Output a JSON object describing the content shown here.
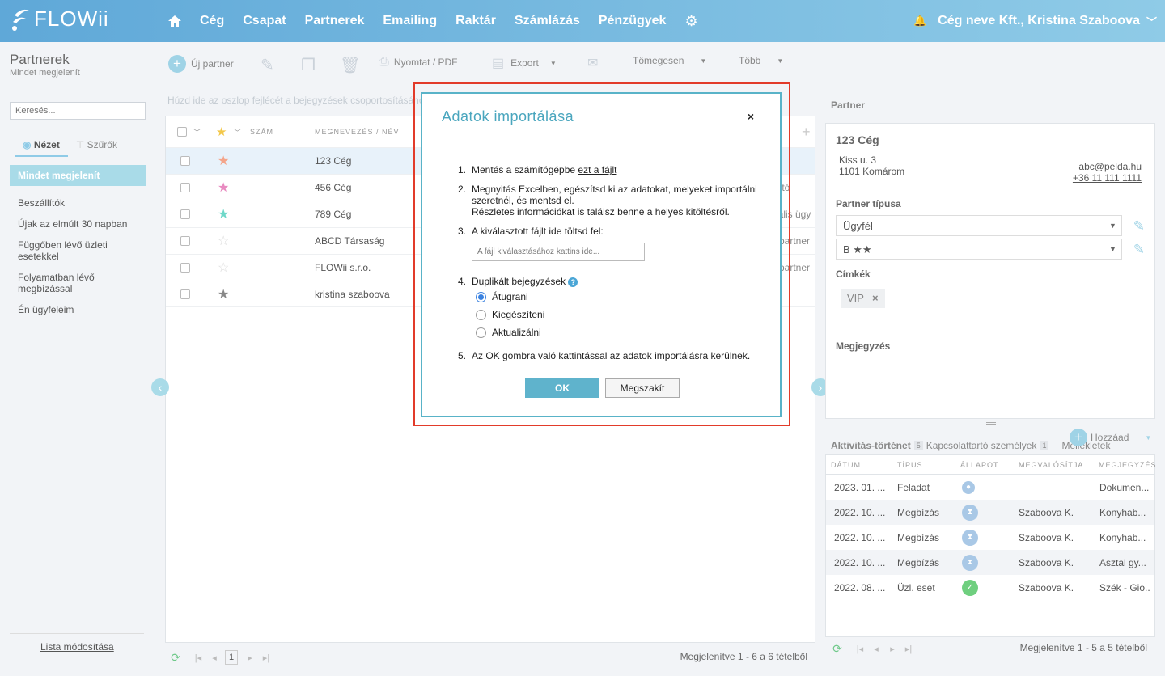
{
  "app": {
    "logo_text": "FLOWii"
  },
  "nav": {
    "items": [
      "Cég",
      "Csapat",
      "Partnerek",
      "Emailing",
      "Raktár",
      "Számlázás",
      "Pénzügyek"
    ]
  },
  "company": {
    "name": "Cég neve Kft., Kristina Szaboova"
  },
  "sidebar": {
    "title": "Partnerek",
    "subtitle": "Mindet megjelenít",
    "search_placeholder": "Keresés...",
    "tab_view": "Nézet",
    "tab_filters": "Szűrők",
    "items": [
      "Mindet megjelenít",
      "Beszállítók",
      "Újak az elmúlt 30 napban",
      "Függőben lévő üzleti esetekkel",
      "Folyamatban lévő megbízással",
      "Én ügyfeleim"
    ],
    "edit_list": "Lista módosítása"
  },
  "toolbar": {
    "new_partner": "Új partner",
    "print": "Nyomtat / PDF",
    "export": "Export",
    "bulk": "Tömegesen",
    "more": "Több"
  },
  "grid": {
    "group_hint": "Húzd ide az oszlop fejlécét a bejegyzések csoportosításához",
    "col_number": "SZÁM",
    "col_name": "MEGNEVEZÉS / NÉV",
    "rows": [
      {
        "name": "123 Cég",
        "star_color": "#f4a58a",
        "right": ""
      },
      {
        "name": "456 Cég",
        "star_color": "#e88ac0",
        "right": "ító"
      },
      {
        "name": "789 Cég",
        "star_color": "#6fd8c9",
        "right": "iális ügy"
      },
      {
        "name": "ABCD Társaság",
        "star_color": "#dcdcdc",
        "right": "partner"
      },
      {
        "name": "FLOWii s.r.o.",
        "star_color": "#dcdcdc",
        "right": "partner"
      },
      {
        "name": "kristina szaboova",
        "star_color": "#888888",
        "right": ""
      }
    ],
    "page": "1",
    "footer": "Megjelenítve 1 - 6 a 6 tételből"
  },
  "partner": {
    "label": "Partner",
    "name": "123 Cég",
    "address_line1": "Kiss u. 3",
    "address_line2": "1101 Komárom",
    "email": "abc@pelda.hu",
    "phone": "+36 11 111 1111",
    "type_label": "Partner típusa",
    "type_value": "Ügyfél",
    "rating_value": "B ★★",
    "tags_label": "Címkék",
    "tag": "VIP",
    "note_label": "Megjegyzés"
  },
  "activity": {
    "tab_history": "Aktivitás-történet",
    "history_count": "5",
    "tab_contacts": "Kapcsolattartó személyek",
    "contacts_count": "1",
    "tab_attachments": "Mellékletek",
    "add": "Hozzáad",
    "cols": [
      "DÁTUM",
      "TÍPUS",
      "ÁLLAPOT",
      "MEGVALÓSÍTJA",
      "MEGJEGYZÉS"
    ],
    "rows": [
      {
        "date": "2023. 01. ...",
        "type": "Feladat",
        "status_icon": "pending-icon",
        "by": "",
        "note": "Dokumen..."
      },
      {
        "date": "2022. 10. ...",
        "type": "Megbízás",
        "status_icon": "hourglass-icon",
        "by": "Szaboova K.",
        "note": "Konyhab..."
      },
      {
        "date": "2022. 10. ...",
        "type": "Megbízás",
        "status_icon": "hourglass-icon",
        "by": "Szaboova K.",
        "note": "Konyhab..."
      },
      {
        "date": "2022. 10. ...",
        "type": "Megbízás",
        "status_icon": "hourglass-icon",
        "by": "Szaboova K.",
        "note": "Asztal gy..."
      },
      {
        "date": "2022. 08. ...",
        "type": "Üzl. eset",
        "status_icon": "check-icon",
        "by": "Szaboova K.",
        "note": "Szék - Gio..."
      }
    ],
    "footer": "Megjelenítve 1 - 5 a 5 tételből"
  },
  "modal": {
    "title": "Adatok importálása",
    "close": "×",
    "step1_text": "Mentés a számítógépbe ",
    "step1_link": "ezt a fájlt",
    "step2_line1": "Megnyitás Excelben, egészítsd ki az adatokat, melyeket importálni szeretnél, és mentsd el.",
    "step2_line2": "Részletes információkat is találsz benne a helyes kitöltésről.",
    "step3_text": "A kiválasztott fájlt ide töltsd fel:",
    "file_placeholder": "A fájl kiválasztásához kattins ide...",
    "step4_text": "Duplikált bejegyzések",
    "options": [
      "Átugrani",
      "Kiegészíteni",
      "Aktualizálni"
    ],
    "selected_option": "Átugrani",
    "step5_text": "Az OK gombra való kattintással az adatok importálásra kerülnek.",
    "ok": "OK",
    "cancel": "Megszakít"
  },
  "colors": {
    "accent": "#59b3c8",
    "highlight_border": "#e23b2a",
    "topbar": "#6fb3df"
  }
}
